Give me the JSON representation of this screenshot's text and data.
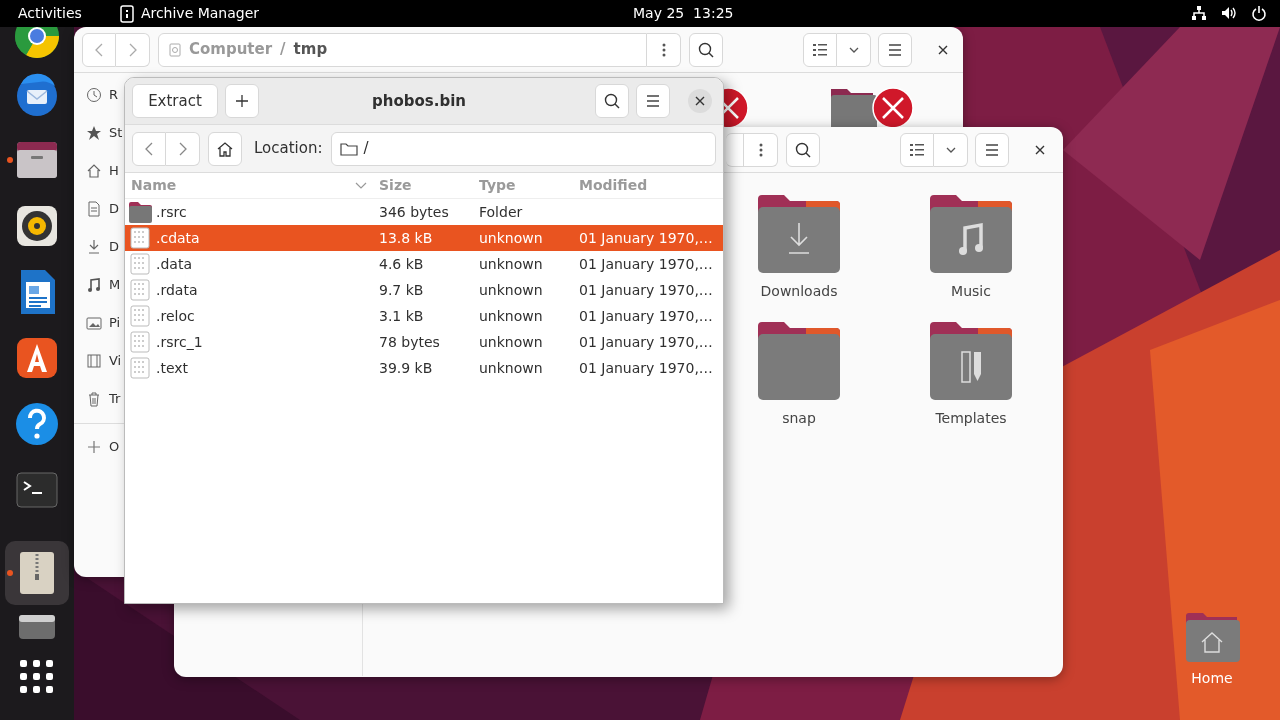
{
  "top_bar": {
    "activities": "Activities",
    "app_name": "Archive Manager",
    "clock": "May 25  13:25"
  },
  "dock": [
    {
      "kind": "browser",
      "running": false,
      "selected": false
    },
    {
      "kind": "mail",
      "running": false,
      "selected": false
    },
    {
      "kind": "files",
      "running": true,
      "selected": false
    },
    {
      "kind": "music",
      "running": false,
      "selected": false
    },
    {
      "kind": "writer",
      "running": false,
      "selected": false
    },
    {
      "kind": "store",
      "running": false,
      "selected": false
    },
    {
      "kind": "help",
      "running": false,
      "selected": false
    },
    {
      "kind": "terminal",
      "running": false,
      "selected": false
    },
    {
      "kind": "archive",
      "running": true,
      "selected": true
    },
    {
      "kind": "drive",
      "running": false,
      "selected": false
    },
    {
      "kind": "grid",
      "running": false,
      "selected": false
    }
  ],
  "files_window_back": {
    "path": [
      {
        "label": "Computer",
        "current": false
      },
      {
        "label": "tmp",
        "current": true
      }
    ],
    "separator": "/",
    "sidebar": [
      {
        "kind": "recent",
        "label": "R"
      },
      {
        "kind": "starred",
        "label": "St"
      },
      {
        "kind": "home",
        "label": "H"
      },
      {
        "kind": "documents",
        "label": "D"
      },
      {
        "kind": "downloads",
        "label": "D"
      },
      {
        "kind": "music",
        "label": "M"
      },
      {
        "kind": "pictures",
        "label": "Pi"
      },
      {
        "kind": "videos",
        "label": "Vi"
      },
      {
        "kind": "trash",
        "label": "Tr"
      },
      {
        "kind": "other",
        "label": "O"
      }
    ]
  },
  "files_window_front": {
    "folders": [
      {
        "kind": "downloads",
        "label": "Downloads"
      },
      {
        "kind": "music",
        "label": "Music"
      },
      {
        "kind": "plain",
        "label": "snap"
      },
      {
        "kind": "templates",
        "label": "Templates"
      }
    ]
  },
  "archive_window": {
    "title": "phobos.bin",
    "extract": "Extract",
    "location_label": "Location:",
    "location": "/",
    "columns": [
      {
        "label": "Name",
        "sorted": true
      },
      {
        "label": "Size",
        "sorted": false
      },
      {
        "label": "Type",
        "sorted": false
      },
      {
        "label": "Modified",
        "sorted": false
      }
    ],
    "rows": [
      {
        "kind": "folder",
        "name": ".rsrc",
        "size": "346 bytes",
        "type": "Folder",
        "selected": false
      },
      {
        "kind": "file",
        "name": ".cdata",
        "size": "13.8 kB",
        "type": "unknown",
        "modified": "01 January 1970,…",
        "selected": true
      },
      {
        "kind": "file",
        "name": ".data",
        "size": "4.6 kB",
        "type": "unknown",
        "modified": "01 January 1970,…",
        "selected": false
      },
      {
        "kind": "file",
        "name": ".rdata",
        "size": "9.7 kB",
        "type": "unknown",
        "modified": "01 January 1970,…",
        "selected": false
      },
      {
        "kind": "file",
        "name": ".reloc",
        "size": "3.1 kB",
        "type": "unknown",
        "modified": "01 January 1970,…",
        "selected": false
      },
      {
        "kind": "file",
        "name": ".rsrc_1",
        "size": "78 bytes",
        "type": "unknown",
        "modified": "01 January 1970,…",
        "selected": false
      },
      {
        "kind": "file",
        "name": ".text",
        "size": "39.9 kB",
        "type": "unknown",
        "modified": "01 January 1970,…",
        "selected": false
      }
    ]
  },
  "desktop_icons": [
    {
      "label": "Home"
    }
  ]
}
